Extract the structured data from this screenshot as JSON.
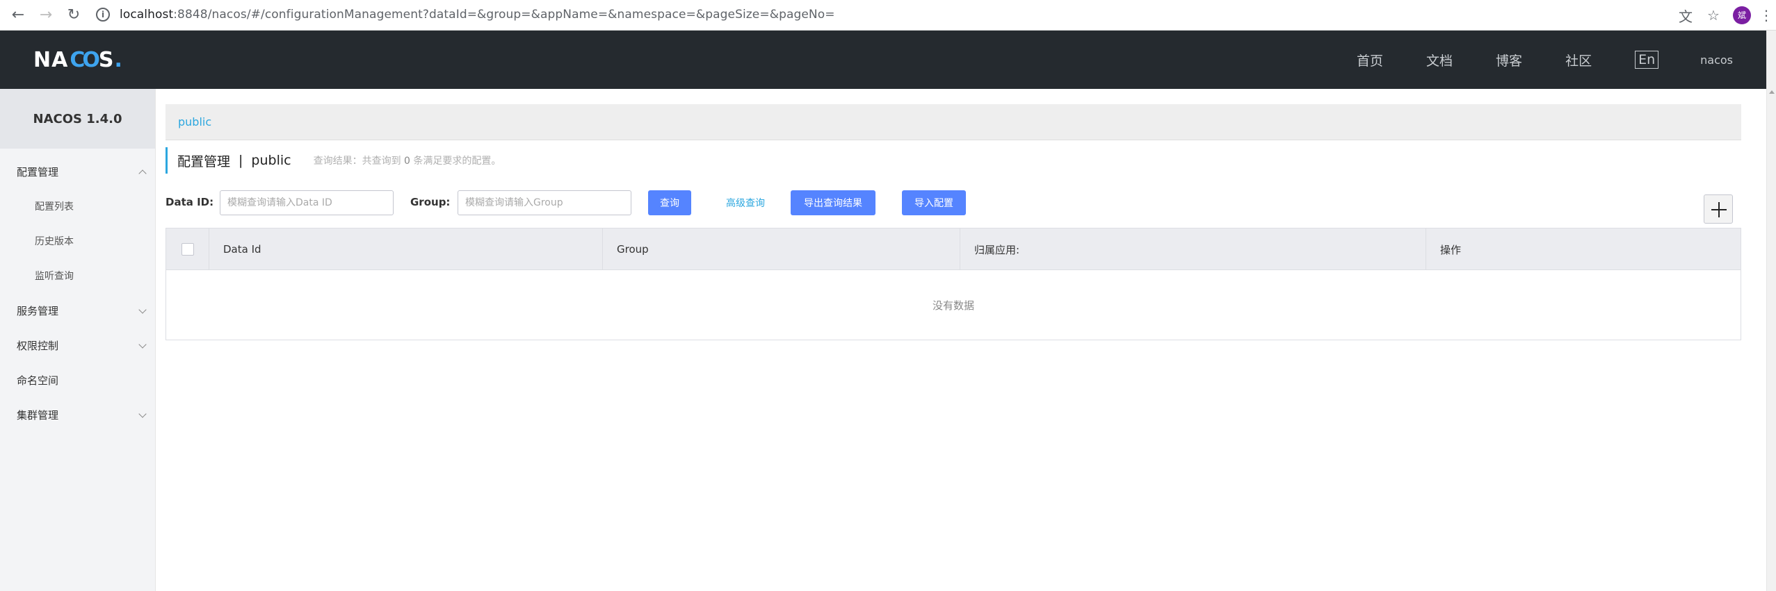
{
  "browser": {
    "url_host": "localhost",
    "url_rest": ":8848/nacos/#/configurationManagement?dataId=&group=&appName=&namespace=&pageSize=&pageNo=",
    "avatar_text": "斌"
  },
  "header": {
    "logo_left": "NA",
    "logo_mid": "CO",
    "logo_right": "S",
    "logo_dot": ".",
    "nav": [
      "首页",
      "文档",
      "博客",
      "社区"
    ],
    "lang": "En",
    "user": "nacos"
  },
  "sidebar": {
    "version": "NACOS 1.4.0",
    "items": [
      {
        "label": "配置管理"
      },
      {
        "label": "配置列表"
      },
      {
        "label": "历史版本"
      },
      {
        "label": "监听查询"
      },
      {
        "label": "服务管理"
      },
      {
        "label": "权限控制"
      },
      {
        "label": "命名空间"
      },
      {
        "label": "集群管理"
      }
    ]
  },
  "main": {
    "namespace_tab": "public",
    "title": "配置管理",
    "separator": "|",
    "title_ns": "public",
    "result_prefix": "查询结果：共查询到",
    "result_count": "0",
    "result_suffix": "条满足要求的配置。",
    "filter": {
      "dataid_label": "Data ID:",
      "dataid_placeholder": "模糊查询请输入Data ID",
      "group_label": "Group:",
      "group_placeholder": "模糊查询请输入Group",
      "query_button": "查询",
      "advanced_query": "高级查询",
      "export_button": "导出查询结果",
      "import_button": "导入配置"
    },
    "table": {
      "columns": [
        "Data Id",
        "Group",
        "归属应用:",
        "操作"
      ],
      "empty_text": "没有数据"
    }
  }
}
